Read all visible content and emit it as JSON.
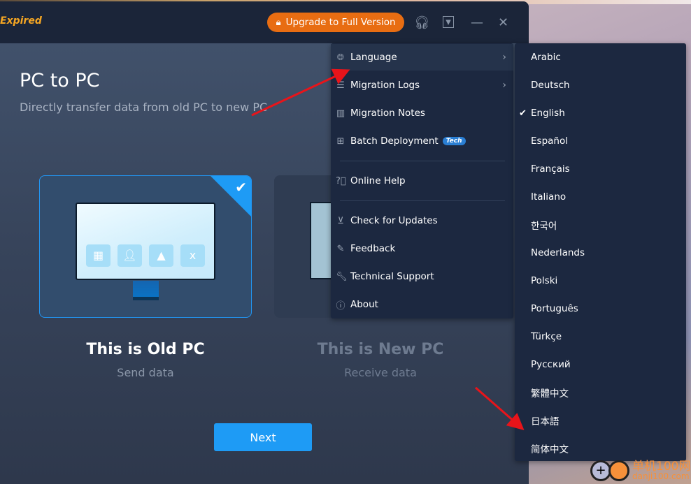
{
  "titlebar": {
    "status": "Expired",
    "upgrade_label": "Upgrade to Full Version"
  },
  "main": {
    "title": "PC to PC",
    "subtitle": "Directly transfer data from old PC to new PC",
    "cards": [
      {
        "title": "This is Old PC",
        "subtitle": "Send data",
        "selected": true
      },
      {
        "title": "This is New PC",
        "subtitle": "Receive data",
        "selected": false
      }
    ],
    "next_label": "Next"
  },
  "menu": {
    "items": [
      {
        "label": "Language",
        "icon": "globe-icon",
        "submenu": true
      },
      {
        "label": "Migration Logs",
        "icon": "document-icon",
        "submenu": true
      },
      {
        "label": "Migration Notes",
        "icon": "book-icon"
      },
      {
        "label": "Batch Deployment",
        "icon": "hierarchy-icon",
        "badge": "Tech"
      },
      {
        "label": "Online Help",
        "icon": "question-icon"
      },
      {
        "label": "Check for Updates",
        "icon": "download-icon"
      },
      {
        "label": "Feedback",
        "icon": "feedback-icon"
      },
      {
        "label": "Technical Support",
        "icon": "wrench-icon"
      },
      {
        "label": "About",
        "icon": "info-icon"
      }
    ]
  },
  "languages": {
    "selected": "English",
    "items": [
      "Arabic",
      "Deutsch",
      "English",
      "Español",
      "Français",
      "Italiano",
      "한국어",
      "Nederlands",
      "Polski",
      "Português",
      "Türkçe",
      "Русский",
      "繁體中文",
      "日本語",
      "简体中文"
    ]
  },
  "watermark": {
    "text": "单机100网",
    "url": "danji100.com"
  },
  "colors": {
    "accent": "#1e9bf5",
    "upgrade": "#e86d12",
    "expired": "#f5a623",
    "annotation": "#e8141a"
  }
}
